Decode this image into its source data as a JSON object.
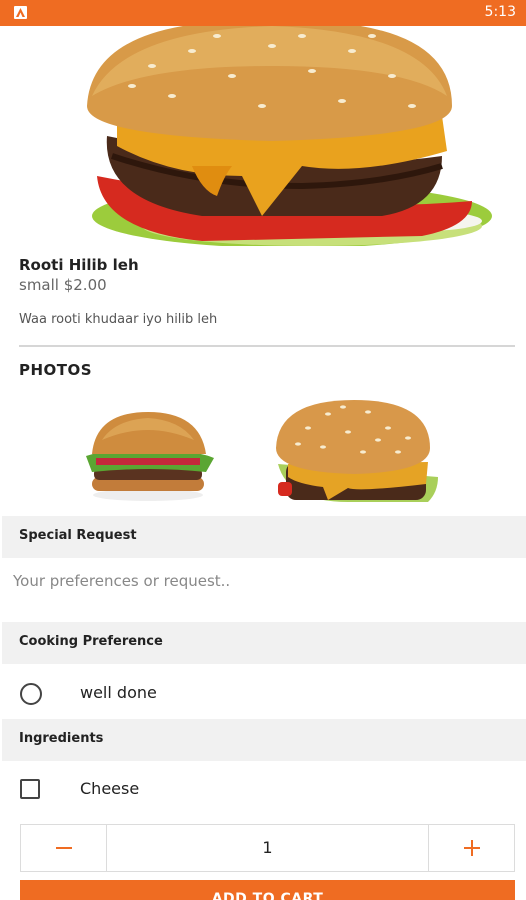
{
  "status_bar": {
    "time": "5:13",
    "app_icon": "app-icon"
  },
  "item": {
    "name": "Rooti Hilib leh",
    "price": "small $2.00",
    "description": "Waa rooti khudaar iyo hilib leh"
  },
  "photos": {
    "title": "PHOTOS",
    "count": 2
  },
  "special_request": {
    "header": "Special Request",
    "placeholder": "Your preferences or request.."
  },
  "cooking_preference": {
    "header": "Cooking Preference",
    "options": [
      {
        "label": "well done",
        "selected": false
      }
    ]
  },
  "ingredients": {
    "header": "Ingredients",
    "options": [
      {
        "label": "Cheese",
        "checked": false
      }
    ]
  },
  "quantity": {
    "value": "1",
    "minus_icon": "minus-icon",
    "plus_icon": "plus-icon"
  },
  "cart": {
    "button_label": "ADD TO CART"
  },
  "colors": {
    "accent": "#ef6c22",
    "section_bg": "#f1f1f1"
  }
}
